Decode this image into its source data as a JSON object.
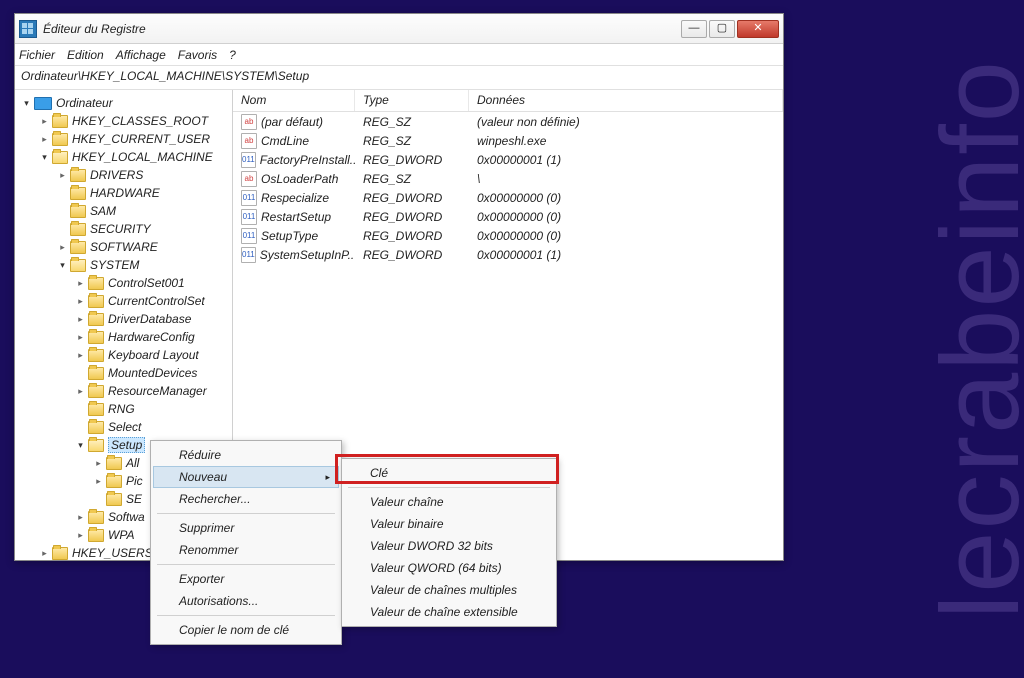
{
  "watermark": "lecrabeinfo",
  "window": {
    "title": "Éditeur du Registre",
    "menu": [
      "Fichier",
      "Edition",
      "Affichage",
      "Favoris",
      "?"
    ],
    "address": "Ordinateur\\HKEY_LOCAL_MACHINE\\SYSTEM\\Setup"
  },
  "tree": [
    {
      "ind": 0,
      "exp": "open",
      "icon": "comp",
      "lbl": "Ordinateur"
    },
    {
      "ind": 1,
      "exp": "closed",
      "icon": "fold",
      "lbl": "HKEY_CLASSES_ROOT"
    },
    {
      "ind": 1,
      "exp": "closed",
      "icon": "fold",
      "lbl": "HKEY_CURRENT_USER"
    },
    {
      "ind": 1,
      "exp": "open",
      "icon": "fold-open",
      "lbl": "HKEY_LOCAL_MACHINE"
    },
    {
      "ind": 2,
      "exp": "closed",
      "icon": "fold",
      "lbl": "DRIVERS"
    },
    {
      "ind": 2,
      "exp": "none",
      "icon": "fold",
      "lbl": "HARDWARE"
    },
    {
      "ind": 2,
      "exp": "none",
      "icon": "fold",
      "lbl": "SAM"
    },
    {
      "ind": 2,
      "exp": "none",
      "icon": "fold",
      "lbl": "SECURITY"
    },
    {
      "ind": 2,
      "exp": "closed",
      "icon": "fold",
      "lbl": "SOFTWARE"
    },
    {
      "ind": 2,
      "exp": "open",
      "icon": "fold-open",
      "lbl": "SYSTEM"
    },
    {
      "ind": 3,
      "exp": "closed",
      "icon": "fold",
      "lbl": "ControlSet001"
    },
    {
      "ind": 3,
      "exp": "closed",
      "icon": "fold",
      "lbl": "CurrentControlSet"
    },
    {
      "ind": 3,
      "exp": "closed",
      "icon": "fold",
      "lbl": "DriverDatabase"
    },
    {
      "ind": 3,
      "exp": "closed",
      "icon": "fold",
      "lbl": "HardwareConfig"
    },
    {
      "ind": 3,
      "exp": "closed",
      "icon": "fold",
      "lbl": "Keyboard Layout"
    },
    {
      "ind": 3,
      "exp": "none",
      "icon": "fold",
      "lbl": "MountedDevices"
    },
    {
      "ind": 3,
      "exp": "closed",
      "icon": "fold",
      "lbl": "ResourceManager"
    },
    {
      "ind": 3,
      "exp": "none",
      "icon": "fold",
      "lbl": "RNG"
    },
    {
      "ind": 3,
      "exp": "none",
      "icon": "fold",
      "lbl": "Select"
    },
    {
      "ind": 3,
      "exp": "open",
      "icon": "fold-open",
      "lbl": "Setup",
      "sel": true
    },
    {
      "ind": 4,
      "exp": "closed",
      "icon": "fold",
      "lbl": "All"
    },
    {
      "ind": 4,
      "exp": "closed",
      "icon": "fold",
      "lbl": "Pic"
    },
    {
      "ind": 4,
      "exp": "none",
      "icon": "fold",
      "lbl": "SE"
    },
    {
      "ind": 3,
      "exp": "closed",
      "icon": "fold",
      "lbl": "Softwa"
    },
    {
      "ind": 3,
      "exp": "closed",
      "icon": "fold",
      "lbl": "WPA"
    },
    {
      "ind": 1,
      "exp": "closed",
      "icon": "fold",
      "lbl": "HKEY_USERS"
    }
  ],
  "list": {
    "headers": {
      "name": "Nom",
      "type": "Type",
      "data": "Données"
    },
    "rows": [
      {
        "icon": "sz",
        "name": "(par défaut)",
        "type": "REG_SZ",
        "data": "(valeur non définie)"
      },
      {
        "icon": "sz",
        "name": "CmdLine",
        "type": "REG_SZ",
        "data": "winpeshl.exe"
      },
      {
        "icon": "dw",
        "name": "FactoryPreInstall..",
        "type": "REG_DWORD",
        "data": "0x00000001 (1)"
      },
      {
        "icon": "sz",
        "name": "OsLoaderPath",
        "type": "REG_SZ",
        "data": "\\"
      },
      {
        "icon": "dw",
        "name": "Respecialize",
        "type": "REG_DWORD",
        "data": "0x00000000 (0)"
      },
      {
        "icon": "dw",
        "name": "RestartSetup",
        "type": "REG_DWORD",
        "data": "0x00000000 (0)"
      },
      {
        "icon": "dw",
        "name": "SetupType",
        "type": "REG_DWORD",
        "data": "0x00000000 (0)"
      },
      {
        "icon": "dw",
        "name": "SystemSetupInP..",
        "type": "REG_DWORD",
        "data": "0x00000001 (1)"
      }
    ]
  },
  "ctx1": {
    "reduce": "Réduire",
    "new": "Nouveau",
    "search": "Rechercher...",
    "delete": "Supprimer",
    "rename": "Renommer",
    "export": "Exporter",
    "perms": "Autorisations...",
    "copy": "Copier le nom de clé"
  },
  "ctx2": {
    "key": "Clé",
    "string": "Valeur chaîne",
    "binary": "Valeur binaire",
    "dword": "Valeur DWORD 32 bits",
    "qword": "Valeur QWORD (64 bits)",
    "multi": "Valeur de chaînes multiples",
    "expand": "Valeur de chaîne extensible"
  },
  "iconGlyph": {
    "sz": "ab",
    "dw": "011"
  }
}
